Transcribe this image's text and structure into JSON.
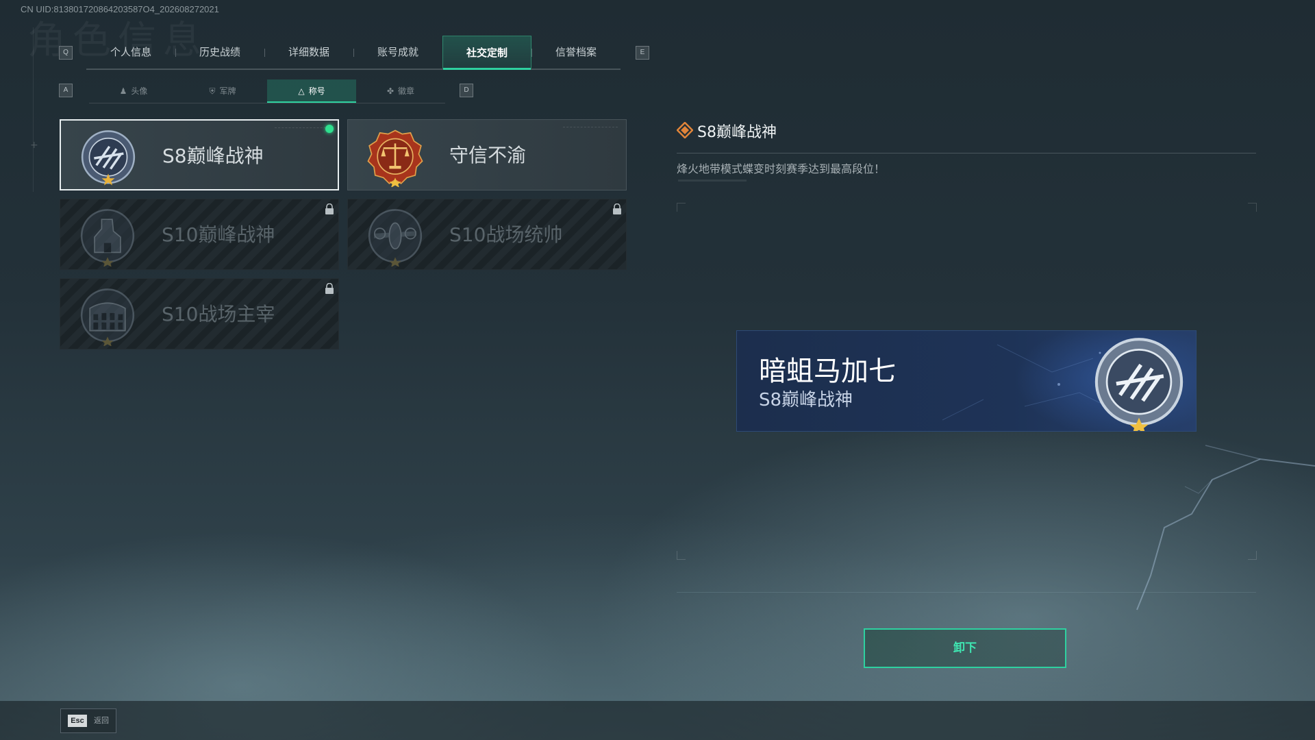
{
  "uid": "CN UID:813801720864203587O4_202608272021",
  "ghost_title": "角色信息",
  "tabs": {
    "prev_key": "Q",
    "next_key": "E",
    "items": [
      {
        "label": "个人信息"
      },
      {
        "label": "历史战绩"
      },
      {
        "label": "详细数据"
      },
      {
        "label": "账号成就"
      },
      {
        "label": "社交定制",
        "active": true
      },
      {
        "label": "信誉档案"
      }
    ]
  },
  "subtabs": {
    "prev_key": "A",
    "next_key": "D",
    "items": [
      {
        "label": "头像",
        "icon": "person-icon"
      },
      {
        "label": "军牌",
        "icon": "shield-icon"
      },
      {
        "label": "称号",
        "icon": "triangle-icon",
        "active": true
      },
      {
        "label": "徽章",
        "icon": "wings-icon"
      }
    ]
  },
  "titles": [
    {
      "name": "S8巅峰战神",
      "icon": "laurel-medal-icon",
      "selected": true,
      "equipped": true,
      "locked": false
    },
    {
      "name": "守信不渝",
      "icon": "scales-of-justice-icon",
      "selected": false,
      "locked": false
    },
    {
      "name": "S10巅峰战神",
      "icon": "tower-medal-icon",
      "locked": true
    },
    {
      "name": "S10战场统帅",
      "icon": "aircraft-medal-icon",
      "locked": true
    },
    {
      "name": "S10战场主宰",
      "icon": "colosseum-medal-icon",
      "locked": true
    }
  ],
  "detail": {
    "title": "S8巅峰战神",
    "description": "烽火地带模式蝶变时刻赛季达到最高段位！"
  },
  "nameplate": {
    "player_name": "暗蛆马加七",
    "title": "S8巅峰战神"
  },
  "unequip_button": "卸下",
  "esc": {
    "key": "Esc",
    "label": "返回"
  },
  "colors": {
    "accent": "#2ed1a0",
    "equipped_dot": "#2fe08f",
    "nameplate_bg": "#1e3357"
  }
}
